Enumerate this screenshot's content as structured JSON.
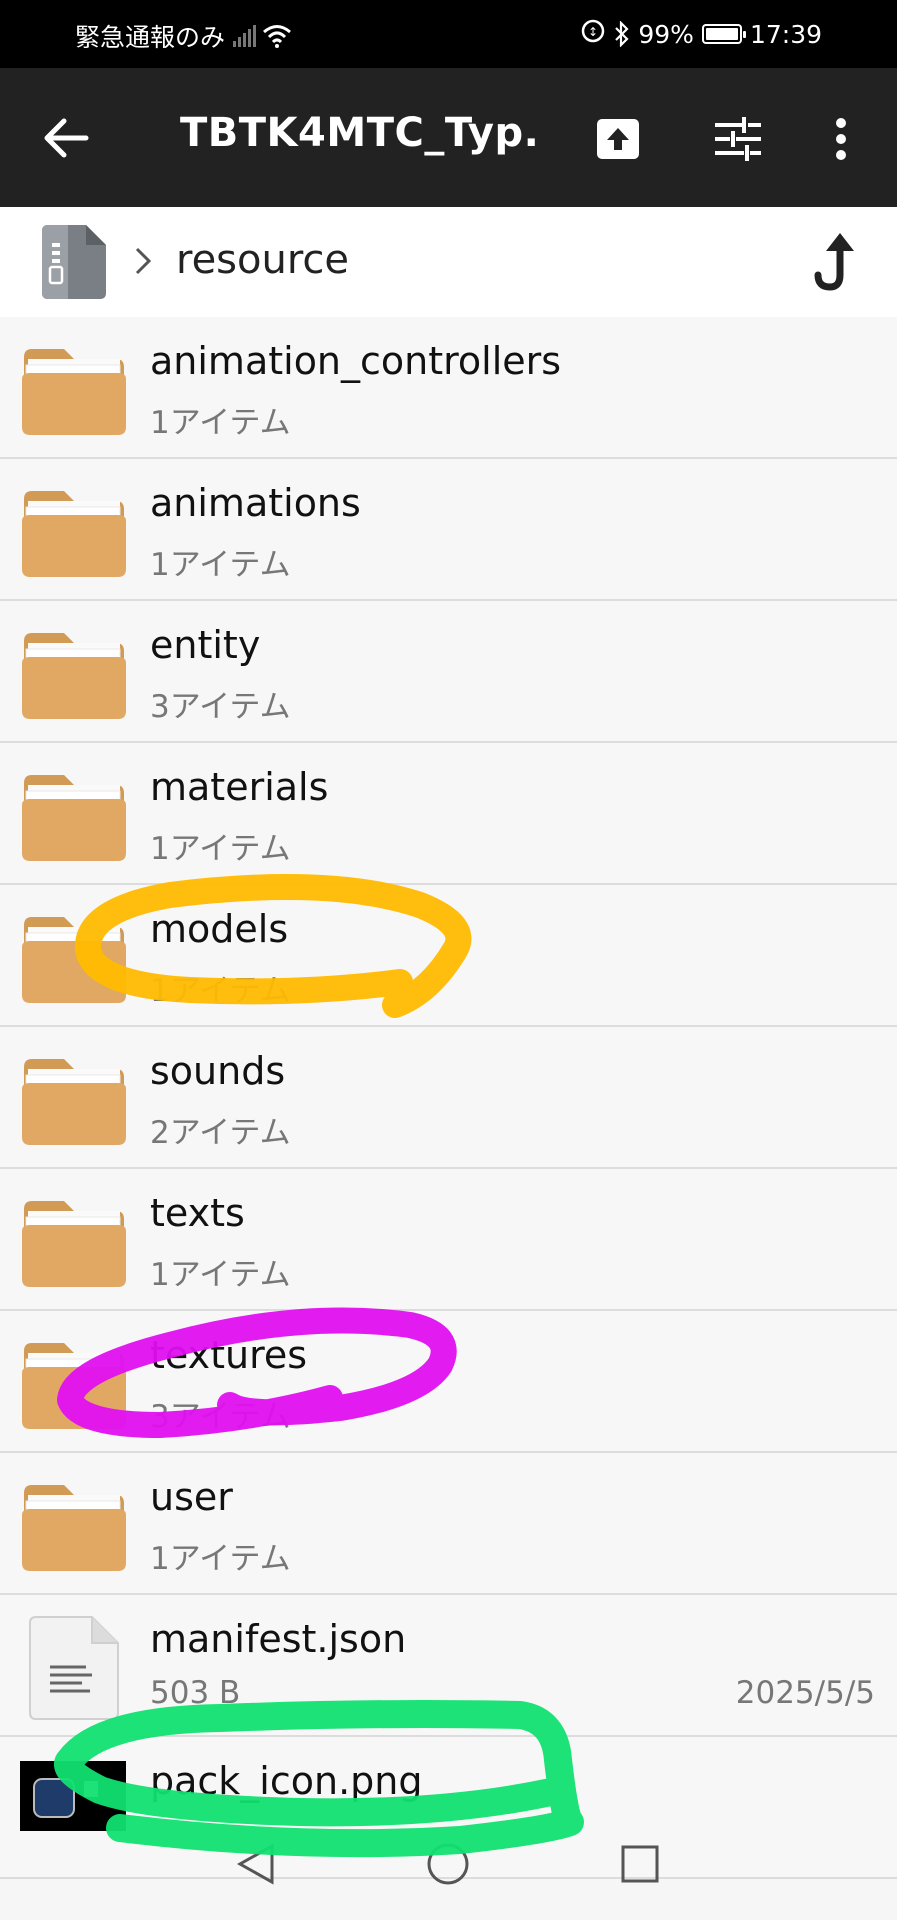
{
  "status_bar": {
    "carrier_text": "緊急通報のみ",
    "battery": "99%",
    "battery_level": 0.99,
    "time": "17:39"
  },
  "app_bar": {
    "title": "TBTK4MTC_Typ..."
  },
  "breadcrumb": {
    "path": "resource"
  },
  "items": [
    {
      "name": "animation_controllers",
      "sub": "1アイテム",
      "type": "folder"
    },
    {
      "name": "animations",
      "sub": "1アイテム",
      "type": "folder"
    },
    {
      "name": "entity",
      "sub": "3アイテム",
      "type": "folder"
    },
    {
      "name": "materials",
      "sub": "1アイテム",
      "type": "folder"
    },
    {
      "name": "models",
      "sub": "1アイテム",
      "type": "folder"
    },
    {
      "name": "sounds",
      "sub": "2アイテム",
      "type": "folder"
    },
    {
      "name": "texts",
      "sub": "1アイテム",
      "type": "folder"
    },
    {
      "name": "textures",
      "sub": "3アイテム",
      "type": "folder"
    },
    {
      "name": "user",
      "sub": "1アイテム",
      "type": "folder"
    },
    {
      "name": "manifest.json",
      "sub": "503 B",
      "date": "2025/5/5",
      "type": "file"
    },
    {
      "name": "pack_icon.png",
      "type": "image"
    }
  ],
  "colors": {
    "folder": "#e0a862",
    "folder_tab": "#d19a55",
    "app_bar": "#222222",
    "highlight_orange": "#ffbb00",
    "highlight_magenta": "#e010f0",
    "highlight_green": "#10e070"
  },
  "icons": {
    "back": "arrow-left-icon",
    "extract": "archive-extract-icon",
    "filter": "sliders-icon",
    "more": "more-vertical-icon",
    "up": "up-arrow-icon",
    "zip": "zip-file-icon"
  }
}
